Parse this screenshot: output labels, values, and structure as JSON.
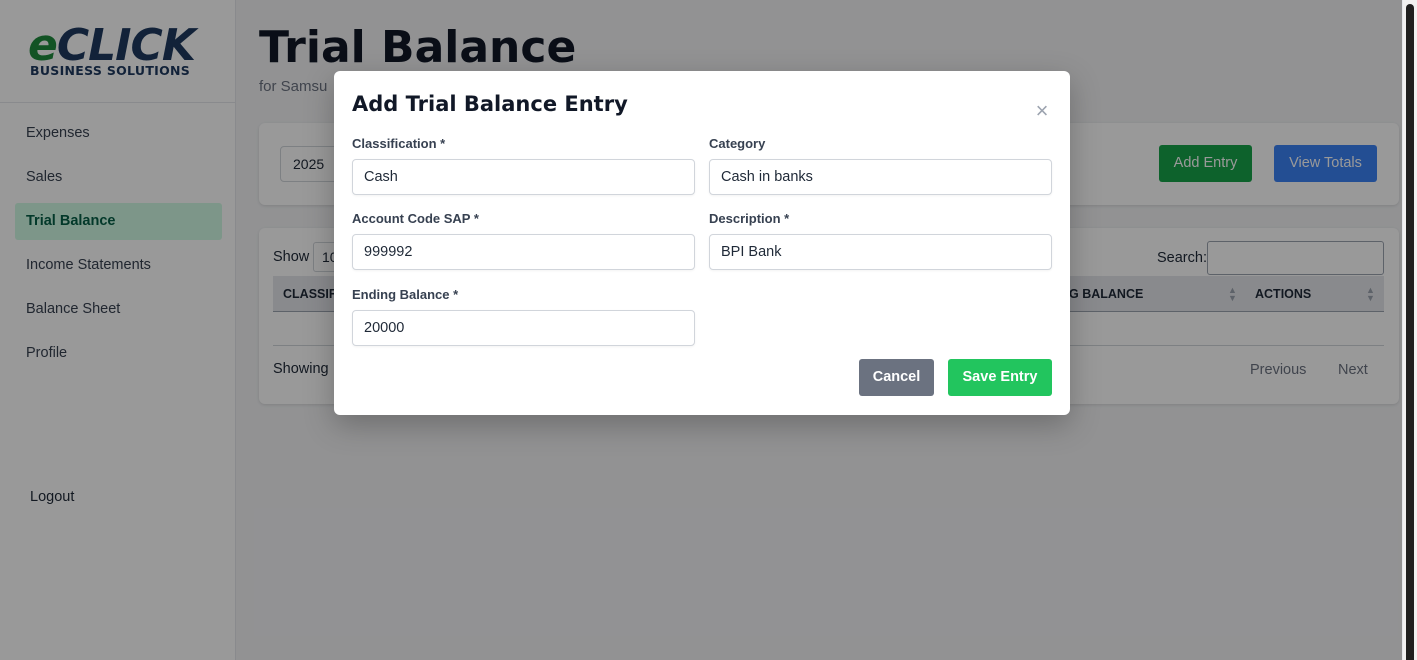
{
  "brand": {
    "logo_e": "e",
    "logo_click": "CLICK",
    "logo_sub": "BUSINESS SOLUTIONS"
  },
  "sidebar": {
    "items": [
      {
        "label": "Expenses"
      },
      {
        "label": "Sales"
      },
      {
        "label": "Trial Balance",
        "active": true
      },
      {
        "label": "Income Statements"
      },
      {
        "label": "Balance Sheet"
      },
      {
        "label": "Profile"
      }
    ],
    "logout": "Logout"
  },
  "header": {
    "title": "Trial Balance",
    "subtitle": "for Samsu"
  },
  "toolbar": {
    "year": "2025",
    "add_entry": "Add Entry",
    "view_totals": "View Totals"
  },
  "table": {
    "show_label": "Show",
    "show_value": "10",
    "search_label": "Search:",
    "columns": [
      "CLASSIF",
      "G BALANCE",
      "ACTIONS"
    ],
    "showing_text": "Showing",
    "previous": "Previous",
    "next": "Next"
  },
  "modal": {
    "title": "Add Trial Balance Entry",
    "close_symbol": "×",
    "fields": {
      "classification": {
        "label": "Classification *",
        "value": "Cash"
      },
      "category": {
        "label": "Category",
        "value": "Cash in banks"
      },
      "account_code": {
        "label": "Account Code SAP *",
        "value": "999992"
      },
      "description": {
        "label": "Description *",
        "value": "BPI Bank"
      },
      "ending_balance": {
        "label": "Ending Balance *",
        "value": "20000"
      }
    },
    "cancel": "Cancel",
    "save": "Save Entry"
  },
  "colors": {
    "accent_green": "#16a34a",
    "accent_blue": "#3b82f6",
    "save_green": "#22c55e",
    "cancel_gray": "#6b7280",
    "active_nav_bg": "#d1fae5"
  }
}
